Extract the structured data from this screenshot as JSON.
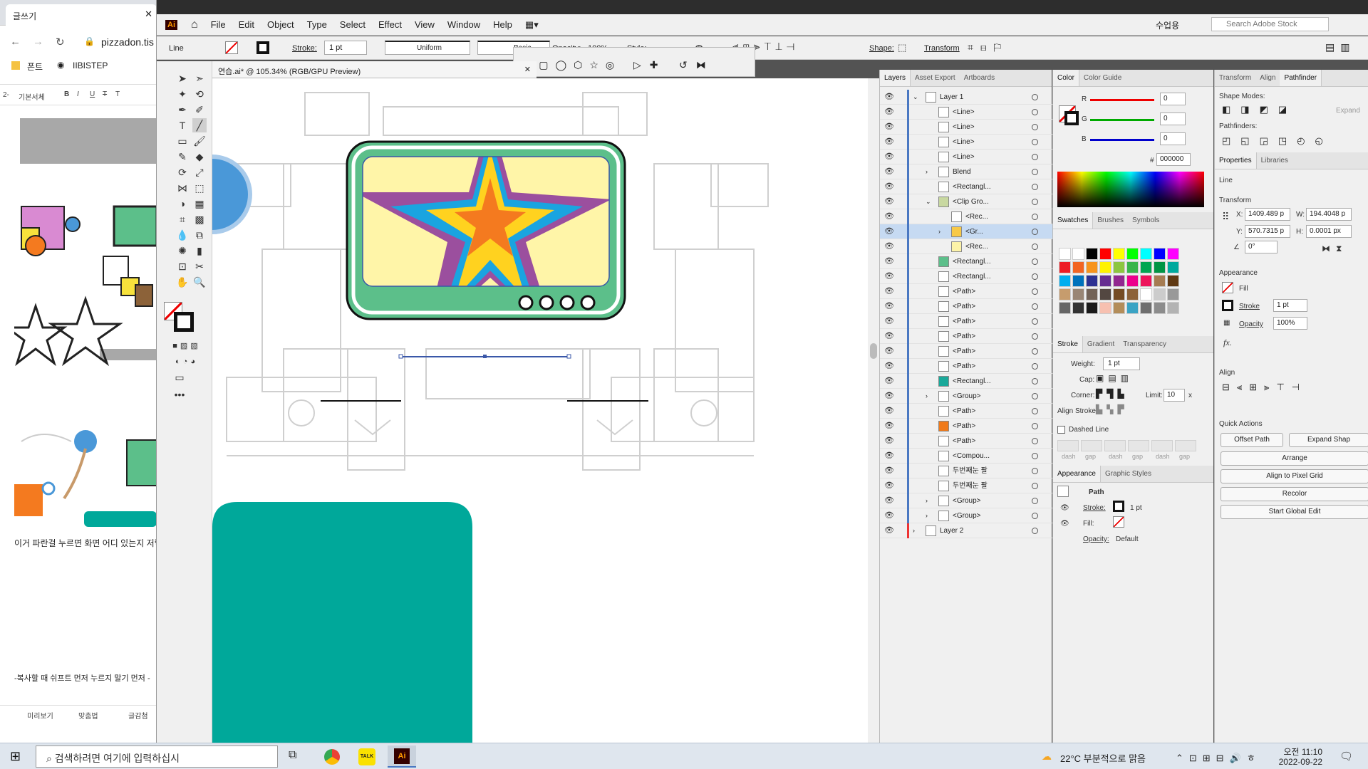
{
  "browser": {
    "tab_title": "글쓰기",
    "url": "pizzadon.tis",
    "bookmarks": [
      "폰트",
      "IIBISTEP"
    ],
    "editor_toolbar": [
      "2-",
      "기본서체"
    ],
    "format_buttons": [
      "B",
      "I",
      "U",
      "T",
      "T"
    ],
    "body_text_1": "이거 파란걸 누르면 화면 어디 있는지 저렇",
    "body_text_2": "-복사할 때 쉬프트 먼저 누르지 말기 먼저 -",
    "status_items": [
      "미리보기",
      "맞춤법",
      "글감첨"
    ]
  },
  "app": {
    "logo": "Ai",
    "menu": [
      "File",
      "Edit",
      "Object",
      "Type",
      "Select",
      "Effect",
      "View",
      "Window",
      "Help"
    ],
    "workspace_label": "수업용",
    "search_placeholder": "Search Adobe Stock"
  },
  "control_bar": {
    "selection_label": "Line",
    "stroke_label": "Stroke:",
    "stroke_weight": "1 pt",
    "profile_label": "Uniform",
    "brush_label": "Basic",
    "opacity_label": "Opacity:",
    "opacity_value": "100%",
    "style_label": "Style:",
    "shape_label": "Shape:",
    "transform_label": "Transform"
  },
  "document": {
    "tab_title": "연습.ai* @ 105.34% (RGB/GPU Preview)"
  },
  "layers_panel": {
    "tabs": [
      "Layers",
      "Asset Export",
      "Artboards"
    ],
    "rows": [
      {
        "name": "Layer 1",
        "indent": 0,
        "expand": "v",
        "selected": false,
        "thumb_color": "#ffffff"
      },
      {
        "name": "<Line>",
        "indent": 1,
        "expand": "",
        "selected": false,
        "thumb_color": "#ffffff"
      },
      {
        "name": "<Line>",
        "indent": 1,
        "expand": "",
        "selected": false,
        "thumb_color": "#ffffff"
      },
      {
        "name": "<Line>",
        "indent": 1,
        "expand": "",
        "selected": false,
        "thumb_color": "#ffffff"
      },
      {
        "name": "<Line>",
        "indent": 1,
        "expand": "",
        "selected": false,
        "thumb_color": "#ffffff"
      },
      {
        "name": "Blend",
        "indent": 1,
        "expand": ">",
        "selected": false,
        "thumb_color": "#ffffff"
      },
      {
        "name": "<Rectangl...",
        "indent": 1,
        "expand": "",
        "selected": false,
        "thumb_color": "#ffffff"
      },
      {
        "name": "<Clip Gro...",
        "indent": 1,
        "expand": "v",
        "selected": false,
        "thumb_color": "#c8d8a0"
      },
      {
        "name": "<Rec...",
        "indent": 2,
        "expand": "",
        "selected": false,
        "thumb_color": "#ffffff"
      },
      {
        "name": "<Gr...",
        "indent": 2,
        "expand": ">",
        "selected": true,
        "thumb_color": "#f7c948"
      },
      {
        "name": "<Rec...",
        "indent": 2,
        "expand": "",
        "selected": false,
        "thumb_color": "#fdf3a8"
      },
      {
        "name": "<Rectangl...",
        "indent": 1,
        "expand": "",
        "selected": false,
        "thumb_color": "#5cbf8a"
      },
      {
        "name": "<Rectangl...",
        "indent": 1,
        "expand": "",
        "selected": false,
        "thumb_color": "#ffffff"
      },
      {
        "name": "<Path>",
        "indent": 1,
        "expand": "",
        "selected": false,
        "thumb_color": "#ffffff"
      },
      {
        "name": "<Path>",
        "indent": 1,
        "expand": "",
        "selected": false,
        "thumb_color": "#ffffff"
      },
      {
        "name": "<Path>",
        "indent": 1,
        "expand": "",
        "selected": false,
        "thumb_color": "#ffffff"
      },
      {
        "name": "<Path>",
        "indent": 1,
        "expand": "",
        "selected": false,
        "thumb_color": "#ffffff"
      },
      {
        "name": "<Path>",
        "indent": 1,
        "expand": "",
        "selected": false,
        "thumb_color": "#ffffff"
      },
      {
        "name": "<Path>",
        "indent": 1,
        "expand": "",
        "selected": false,
        "thumb_color": "#ffffff"
      },
      {
        "name": "<Rectangl...",
        "indent": 1,
        "expand": "",
        "selected": false,
        "thumb_color": "#1aa99a"
      },
      {
        "name": "<Group>",
        "indent": 1,
        "expand": ">",
        "selected": false,
        "thumb_color": "#ffffff"
      },
      {
        "name": "<Path>",
        "indent": 1,
        "expand": "",
        "selected": false,
        "thumb_color": "#ffffff"
      },
      {
        "name": "<Path>",
        "indent": 1,
        "expand": "",
        "selected": false,
        "thumb_color": "#f07a1a"
      },
      {
        "name": "<Path>",
        "indent": 1,
        "expand": "",
        "selected": false,
        "thumb_color": "#ffffff"
      },
      {
        "name": "<Compou...",
        "indent": 1,
        "expand": "",
        "selected": false,
        "thumb_color": "#ffffff"
      },
      {
        "name": "두번째눈 팔",
        "indent": 1,
        "expand": "",
        "selected": false,
        "thumb_color": "#ffffff"
      },
      {
        "name": "두번째눈 팔",
        "indent": 1,
        "expand": "",
        "selected": false,
        "thumb_color": "#ffffff"
      },
      {
        "name": "<Group>",
        "indent": 1,
        "expand": ">",
        "selected": false,
        "thumb_color": "#ffffff"
      },
      {
        "name": "<Group>",
        "indent": 1,
        "expand": ">",
        "selected": false,
        "thumb_color": "#ffffff"
      },
      {
        "name": "Layer 2",
        "indent": 0,
        "expand": ">",
        "selected": false,
        "thumb_color": "#ffffff"
      }
    ]
  },
  "color_panel": {
    "tabs": [
      "Color",
      "Color Guide"
    ],
    "r_label": "R",
    "g_label": "G",
    "b_label": "B",
    "r": "0",
    "g": "0",
    "b": "0",
    "hex_label": "#",
    "hex": "000000"
  },
  "swatches_panel": {
    "tabs": [
      "Swatches",
      "Brushes",
      "Symbols"
    ],
    "rows": [
      [
        "#ffffff",
        "#ffffff",
        "#000000",
        "#ff0000",
        "#ffff00",
        "#00ff00",
        "#00ffff",
        "#0000ff",
        "#ff00ff"
      ],
      [
        "#ed1c24",
        "#f26522",
        "#f7941d",
        "#fff200",
        "#8dc63f",
        "#39b54a",
        "#00a651",
        "#009444",
        "#00a99d"
      ],
      [
        "#00aeef",
        "#0072bc",
        "#2e3192",
        "#662d91",
        "#92278f",
        "#ec008c",
        "#ed145b",
        "#a67c52",
        "#603913"
      ],
      [
        "#c69c6d",
        "#998675",
        "#736357",
        "#534741",
        "#754c24",
        "#8c6239",
        "#ffffff",
        "#cccccc",
        "#999999"
      ],
      [
        "#666666",
        "#333333",
        "#1a1a1a",
        "#f7c0b0",
        "#b38d5a",
        "#3aa3c4",
        "#6e6e6e",
        "#8c8c8c",
        "#b3b3b3"
      ]
    ]
  },
  "stroke_panel": {
    "tabs": [
      "Stroke",
      "Gradient",
      "Transparency"
    ],
    "weight_label": "Weight:",
    "weight": "1 pt",
    "cap_label": "Cap:",
    "corner_label": "Corner:",
    "limit_label": "Limit:",
    "limit": "10",
    "limit_unit": "x",
    "align_label": "Align Stroke:",
    "dashed_label": "Dashed Line",
    "dash_labels": [
      "dash",
      "gap",
      "dash",
      "gap",
      "dash",
      "gap"
    ]
  },
  "appearance_panel": {
    "tabs": [
      "Appearance",
      "Graphic Styles"
    ],
    "object": "Path",
    "stroke_label": "Stroke:",
    "stroke_value": "1 pt",
    "fill_label": "Fill:",
    "opacity_label": "Opacity:",
    "opacity_value": "Default"
  },
  "transform_panel": {
    "tabs": [
      "Transform",
      "Align",
      "Pathfinder"
    ],
    "shape_modes": "Shape Modes:",
    "expand": "Expand",
    "pathfinders": "Pathfinders:"
  },
  "properties_panel": {
    "tabs": [
      "Properties",
      "Libraries"
    ],
    "object": "Line",
    "transform_title": "Transform",
    "x_label": "X:",
    "x": "1409.489 p",
    "y_label": "Y:",
    "y": "570.7315 p",
    "w_label": "W:",
    "w": "194.4048 p",
    "h_label": "H:",
    "h": "0.0001 px",
    "angle": "0°",
    "appearance_title": "Appearance",
    "fill_label": "Fill",
    "stroke_label": "Stroke",
    "stroke_weight": "1 pt",
    "opacity_label": "Opacity",
    "opacity": "100%",
    "fx": "fx.",
    "align_title": "Align",
    "quick_actions": "Quick Actions",
    "offset_path": "Offset Path",
    "expand_shape": "Expand Shap",
    "arrange": "Arrange",
    "align_pixel": "Align to Pixel Grid",
    "recolor": "Recolor",
    "global_edit": "Start Global Edit"
  },
  "taskbar": {
    "search_placeholder": "검색하려면 여기에 입력하십시",
    "weather": "22°C 부분적으로 맑음",
    "time": "오전 11:10",
    "date": "2022-09-22",
    "kakao": "TALK",
    "ai": "Ai"
  },
  "colors": {
    "tv_green": "#5cbf8a",
    "screen_yellow": "#fff5a8",
    "star_purple": "#9b4f9e",
    "star_blue": "#1aa4e0",
    "star_yellow": "#ffd21f",
    "star_orange": "#f47a1f",
    "teal": "#00a89a",
    "blue_circle": "#4a98d8"
  }
}
